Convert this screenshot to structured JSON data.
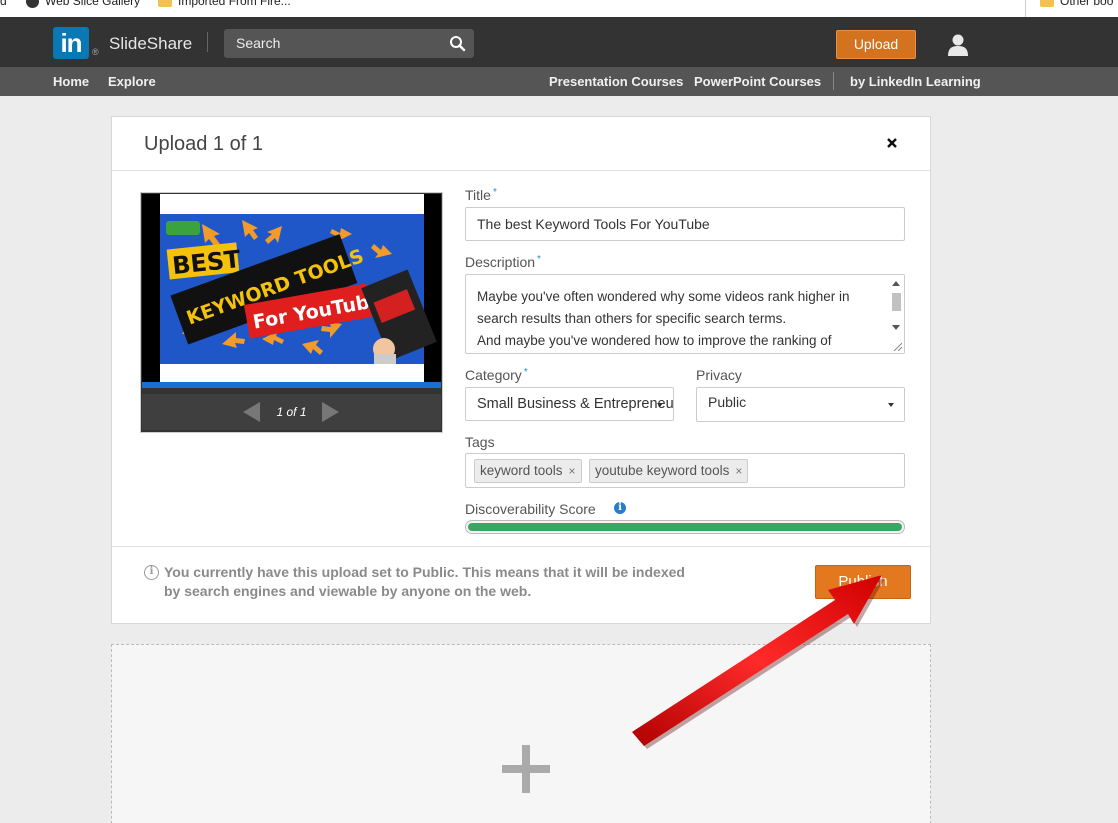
{
  "bookmarks": {
    "items": [
      "d",
      "Web Slice Gallery",
      "Imported From Fire...",
      "Other boo"
    ]
  },
  "header": {
    "logo_text": "in",
    "logo_reg": "®",
    "brand": "SlideShare",
    "search_placeholder": "Search",
    "upload_label": "Upload"
  },
  "subnav": {
    "home": "Home",
    "explore": "Explore",
    "presentation_courses": "Presentation Courses",
    "powerpoint_courses": "PowerPoint Courses",
    "linkedin_learning": "by LinkedIn Learning"
  },
  "panel": {
    "title": "Upload 1 of 1",
    "preview": {
      "page_label": "1 of 1",
      "image_text_line1": "BEST",
      "image_text_line2": "KEYWORD TOOLS",
      "image_text_line3": "For YouTube"
    },
    "form": {
      "title_label": "Title",
      "title_value": "The best Keyword Tools For YouTube",
      "description_label": "Description",
      "description_value": "Maybe you've often wondered why some videos rank higher in search results than others for specific search terms.\nAnd maybe you've wondered how to improve the ranking of",
      "category_label": "Category",
      "category_value": "Small Business & Entrepreneurship",
      "privacy_label": "Privacy",
      "privacy_value": "Public",
      "tags_label": "Tags",
      "tags": [
        "keyword tools",
        "youtube keyword tools"
      ],
      "tag_remove": "×",
      "discoverability_label": "Discoverability Score",
      "discoverability_score": 1.0,
      "required_mark": "*"
    },
    "footer": {
      "notice": "You currently have this upload set to Public. This means that it will be indexed by search engines and viewable by anyone on the web.",
      "publish_label": "Publish"
    }
  },
  "colors": {
    "nav_bg": "#333333",
    "subnav_bg": "#555555",
    "accent_orange": "#e4781f",
    "linkedin_blue": "#0a78b5",
    "score_green": "#3aa663",
    "annotation_red": "#e01010"
  },
  "icons": {
    "search": "search-icon",
    "user": "user-icon",
    "close": "close-icon",
    "info": "info-icon",
    "plus": "plus-icon"
  }
}
